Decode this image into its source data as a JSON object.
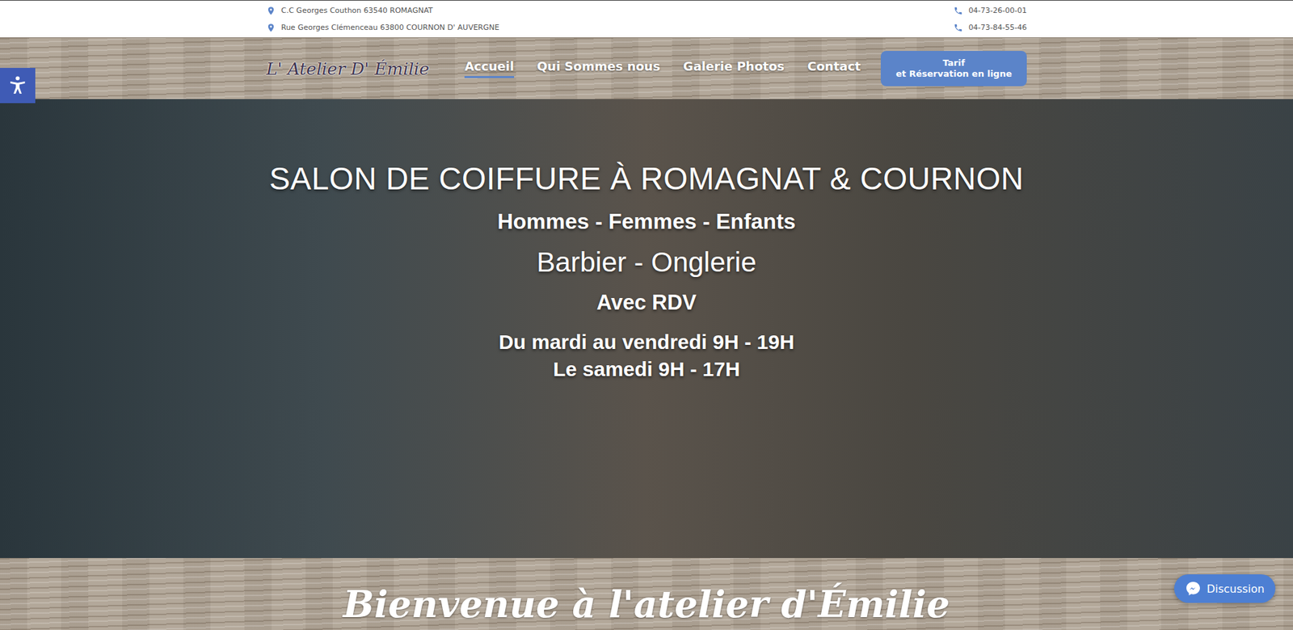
{
  "top_bar": {
    "addresses": [
      "C.C Georges Couthon 63540 ROMAGNAT",
      "Rue Georges Clémenceau 63800 COURNON D' AUVERGNE"
    ],
    "phones": [
      "04-73-26-00-01",
      "04-73-84-55-46"
    ]
  },
  "nav": {
    "logo": "L' Atelier D' Émilie",
    "items": [
      {
        "label": "Accueil",
        "selected": true
      },
      {
        "label": "Qui Sommes nous",
        "selected": false
      },
      {
        "label": "Galerie Photos",
        "selected": false
      },
      {
        "label": "Contact",
        "selected": false
      }
    ],
    "cta": [
      "Tarif",
      "et Réservation en ligne"
    ]
  },
  "hero": {
    "title": "SALON DE COIFFURE À ROMAGNAT & COURNON",
    "audience": "Hommes - Femmes - Enfants",
    "services": "Barbier - Onglerie",
    "booking": "Avec RDV",
    "hours": [
      "Du mardi au vendredi 9H - 19H",
      "Le samedi 9H - 17H"
    ]
  },
  "welcome": {
    "title": "Bienvenue à l'atelier d'Émilie"
  },
  "chat": {
    "label": "Discussion"
  }
}
